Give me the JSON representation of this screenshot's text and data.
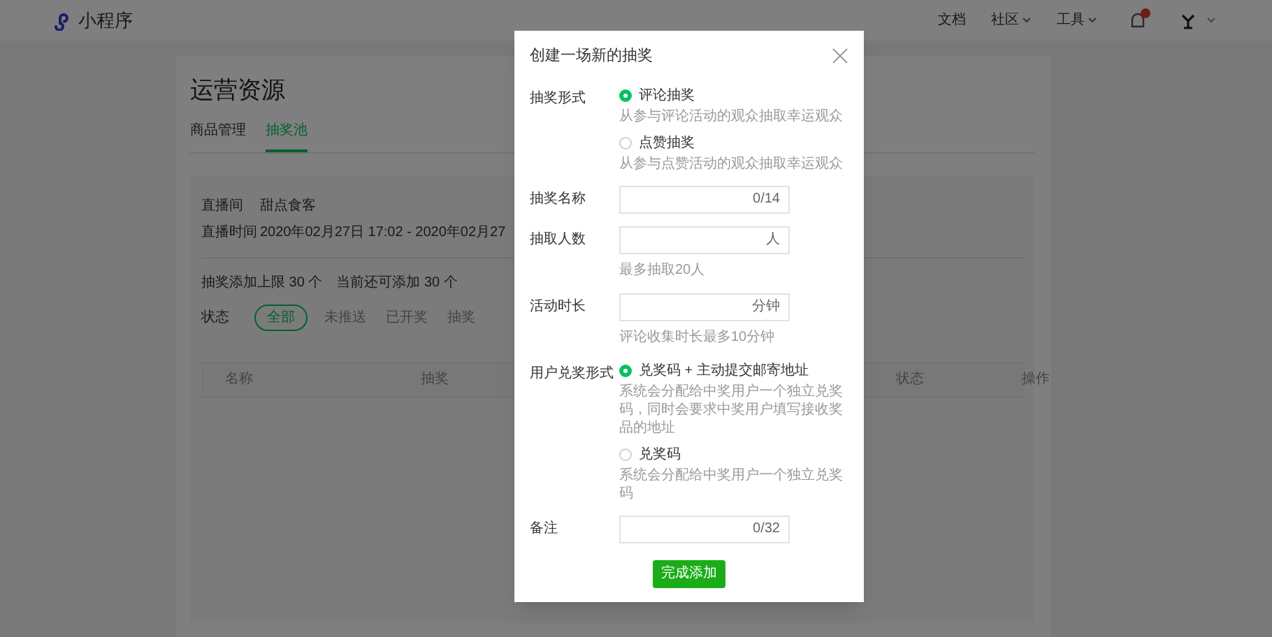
{
  "topbar": {
    "logo_text": "小程序",
    "nav": [
      {
        "label": "文档",
        "has_menu": false
      },
      {
        "label": "社区",
        "has_menu": true
      },
      {
        "label": "工具",
        "has_menu": true
      }
    ],
    "notification_badge": true
  },
  "page": {
    "title": "运营资源",
    "tabs": [
      {
        "label": "商品管理",
        "selected": false
      },
      {
        "label": "抽奖池",
        "selected": true
      }
    ],
    "info": [
      {
        "label": "直播间",
        "value": "甜点食客"
      },
      {
        "label": "直播时间",
        "value": "2020年02月27日 17:02 - 2020年02月27"
      }
    ],
    "limits": [
      "抽奖添加上限 30 个",
      "当前还可添加 30 个"
    ],
    "filter": {
      "label": "状态",
      "options": [
        {
          "label": "全部",
          "selected": true
        },
        {
          "label": "未推送",
          "selected": false
        },
        {
          "label": "已开奖",
          "selected": false
        },
        {
          "label": "抽奖",
          "selected": false
        }
      ]
    },
    "table": {
      "columns": [
        "名称",
        "抽奖",
        "状态",
        "操作"
      ]
    }
  },
  "dialog": {
    "title": "创建一场新的抽奖",
    "rows": [
      {
        "kind": "radio_group",
        "label": "抽奖形式",
        "options": [
          {
            "label": "评论抽奖",
            "description": "从参与评论活动的观众抽取幸运观众",
            "selected": true
          },
          {
            "label": "点赞抽奖",
            "description": "从参与点赞活动的观众抽取幸运观众",
            "selected": false
          }
        ]
      },
      {
        "kind": "field",
        "label": "抽奖名称",
        "suffix": "0/14"
      },
      {
        "kind": "field",
        "label": "抽取人数",
        "suffix": "人",
        "hint": "最多抽取20人"
      },
      {
        "kind": "field",
        "label": "活动时长",
        "suffix": "分钟",
        "hint": "评论收集时长最多10分钟"
      },
      {
        "kind": "radio_group",
        "label": "用户兑奖形式",
        "options": [
          {
            "label": "兑奖码 + 主动提交邮寄地址",
            "description": "系统会分配给中奖用户一个独立兑奖码，同时会要求中奖用户填写接收奖品的地址",
            "selected": true
          },
          {
            "label": "兑奖码",
            "description": "系统会分配给中奖用户一个独立兑奖码",
            "selected": false
          }
        ]
      },
      {
        "kind": "field",
        "label": "备注",
        "suffix": "0/32"
      }
    ],
    "submit": "完成添加"
  }
}
